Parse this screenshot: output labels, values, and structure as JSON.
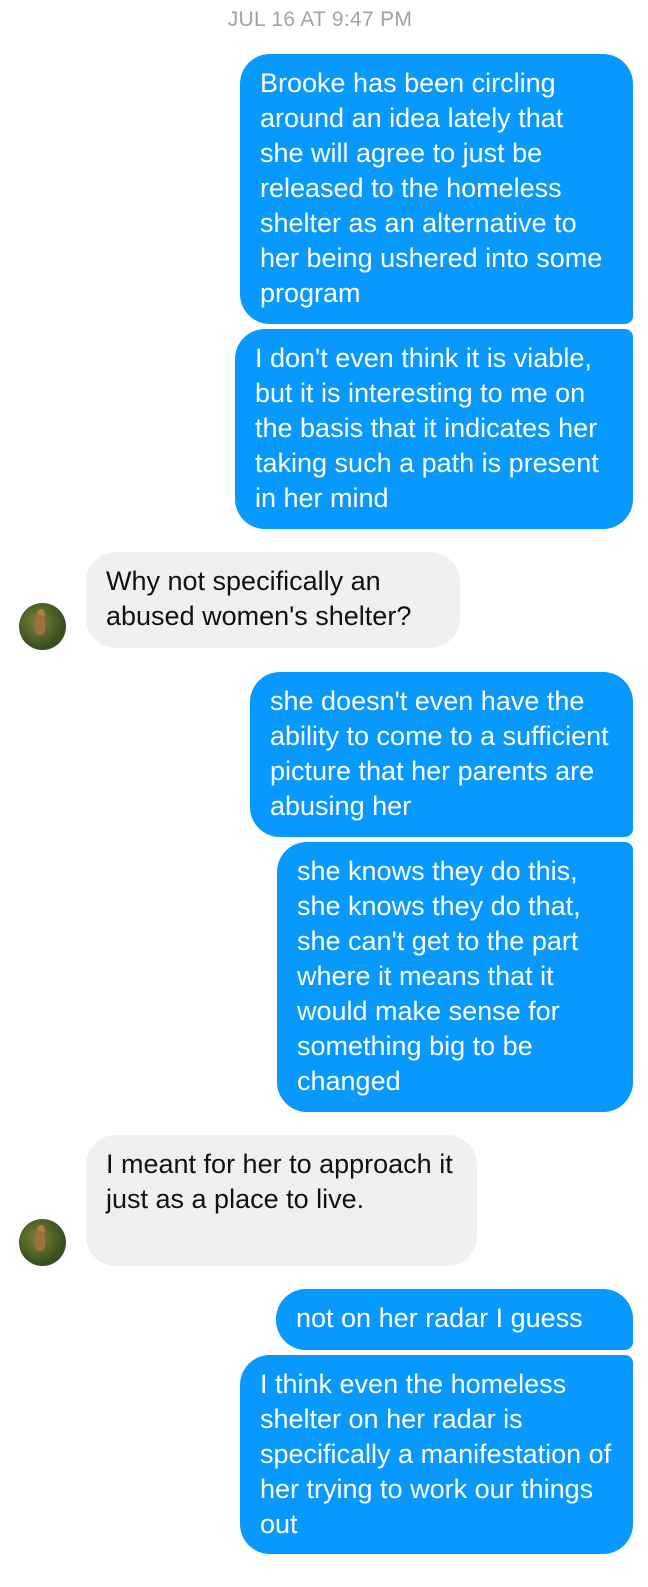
{
  "conversation": {
    "timestamp": "JUL 16 AT 9:47 PM",
    "messages": [
      {
        "from": "me",
        "text": "Brooke has been circling around an idea lately that she will agree to just be released to the homeless shelter as an alternative to her being ushered into some program"
      },
      {
        "from": "me",
        "text": "I don't even think it is viable, but it is interesting to me on the basis that it indicates her taking such a path is present in her mind"
      },
      {
        "from": "them",
        "text": "Why not specifically an abused women's shelter?"
      },
      {
        "from": "me",
        "text": "she doesn't even have the ability to come to a sufficient picture that her parents are abusing her"
      },
      {
        "from": "me",
        "text": "she knows they do this, she knows they do that, she can't get to the part where it means that it would make sense for something big to be changed"
      },
      {
        "from": "them",
        "text": "I meant for her to approach it just as a place to live."
      },
      {
        "from": "me",
        "text": "not on her radar I guess"
      },
      {
        "from": "me",
        "text": "I think even the homeless shelter on her radar is specifically a manifestation of her trying to work our things out"
      }
    ]
  },
  "colors": {
    "outgoing_bubble": "#0899ff",
    "incoming_bubble": "#f0f0f0",
    "timestamp": "#a3a3a3"
  },
  "icons": {
    "contact_avatar": "avatar-icon"
  }
}
